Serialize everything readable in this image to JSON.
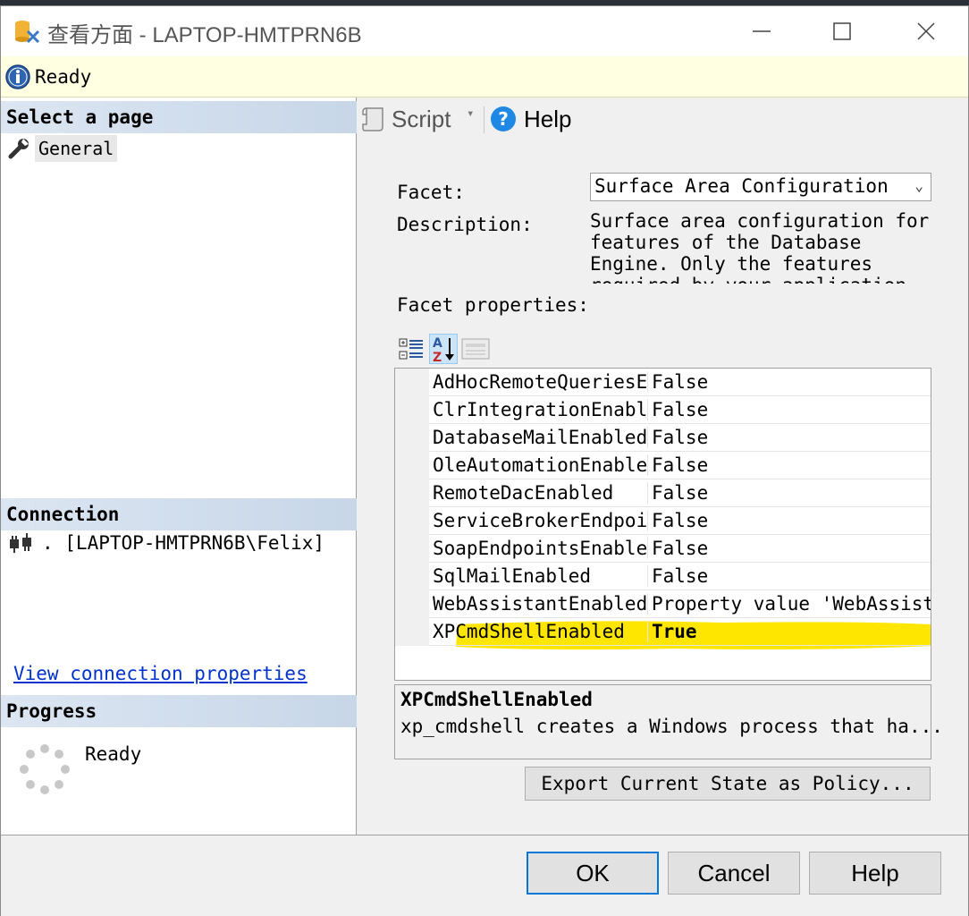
{
  "window": {
    "title": "查看方面 - LAPTOP-HMTPRN6B",
    "controls": {
      "minimize": "—",
      "maximize": "☐",
      "close": "✕"
    }
  },
  "status_bar": {
    "text": "Ready",
    "icon": "info-icon"
  },
  "left_pane": {
    "select_page_header": "Select a page",
    "pages": [
      {
        "label": "General",
        "icon": "wrench-icon"
      }
    ],
    "connection_header": "Connection",
    "connection": {
      "text": ". [LAPTOP-HMTPRN6B\\Felix]",
      "icon": "connection-plug-icon"
    },
    "connection_link": "View connection properties",
    "progress_header": "Progress",
    "progress_status": "Ready"
  },
  "toolbar": {
    "script_label": "Script",
    "script_dropdown": "▾",
    "help_label": "Help"
  },
  "form": {
    "facet_label": "Facet:",
    "facet_value": "Surface Area Configuration",
    "description_label": "Description:",
    "description_lines": [
      "Surface area configuration for",
      "features of the Database",
      "Engine. Only the features",
      "required by your application"
    ],
    "facet_properties_label": "Facet properties:"
  },
  "properties": [
    {
      "name": "AdHocRemoteQueriesEnabled",
      "value": "False"
    },
    {
      "name": "ClrIntegrationEnabled",
      "value": "False"
    },
    {
      "name": "DatabaseMailEnabled",
      "value": "False"
    },
    {
      "name": "OleAutomationEnabled",
      "value": "False"
    },
    {
      "name": "RemoteDacEnabled",
      "value": "False"
    },
    {
      "name": "ServiceBrokerEndpointActive",
      "value": "False"
    },
    {
      "name": "SoapEndpointsEnabled",
      "value": "False"
    },
    {
      "name": "SqlMailEnabled",
      "value": "False"
    },
    {
      "name": "WebAssistantEnabled",
      "value": "Property value 'WebAssistantEnabled'"
    },
    {
      "name": "XPCmdShellEnabled",
      "value": "True"
    }
  ],
  "selected_property": {
    "name": "XPCmdShellEnabled",
    "description": "xp_cmdshell creates a Windows process that ha..."
  },
  "export_button": "Export Current State as Policy...",
  "footer": {
    "ok": "OK",
    "cancel": "Cancel",
    "help": "Help"
  },
  "colors": {
    "highlight": "#ffe600",
    "link": "#0033cc",
    "info_bar": "#ffffe1",
    "section_header": "#c7d6e8"
  }
}
